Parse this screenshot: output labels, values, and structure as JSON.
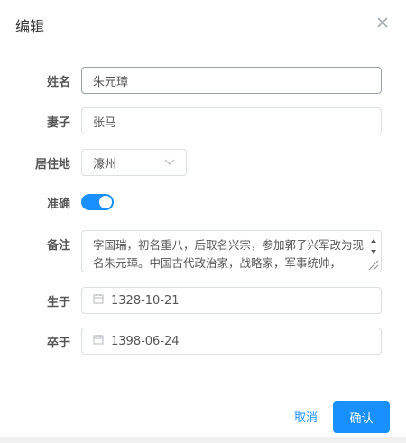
{
  "dialog": {
    "title": "编辑",
    "close_icon": "close-icon"
  },
  "form": {
    "name": {
      "label": "姓名",
      "value": "朱元璋"
    },
    "wife": {
      "label": "妻子",
      "value": "张马"
    },
    "residence": {
      "label": "居住地",
      "value": "濠州",
      "icon": "chevron-down-icon"
    },
    "accurate": {
      "label": "准确",
      "checked": true,
      "color": "#1890ff"
    },
    "note": {
      "label": "备注",
      "value": "字国瑞，初名重八，后取名兴宗，参加郭子兴军改为现名朱元璋。中国古代政治家，战略家，军事统帅，"
    },
    "born": {
      "label": "生于",
      "value": "1328-10-21",
      "icon": "calendar-icon"
    },
    "died": {
      "label": "卒于",
      "value": "1398-06-24",
      "icon": "calendar-icon"
    }
  },
  "footer": {
    "cancel_label": "取消",
    "confirm_label": "确认",
    "accent_color": "#1890ff"
  }
}
